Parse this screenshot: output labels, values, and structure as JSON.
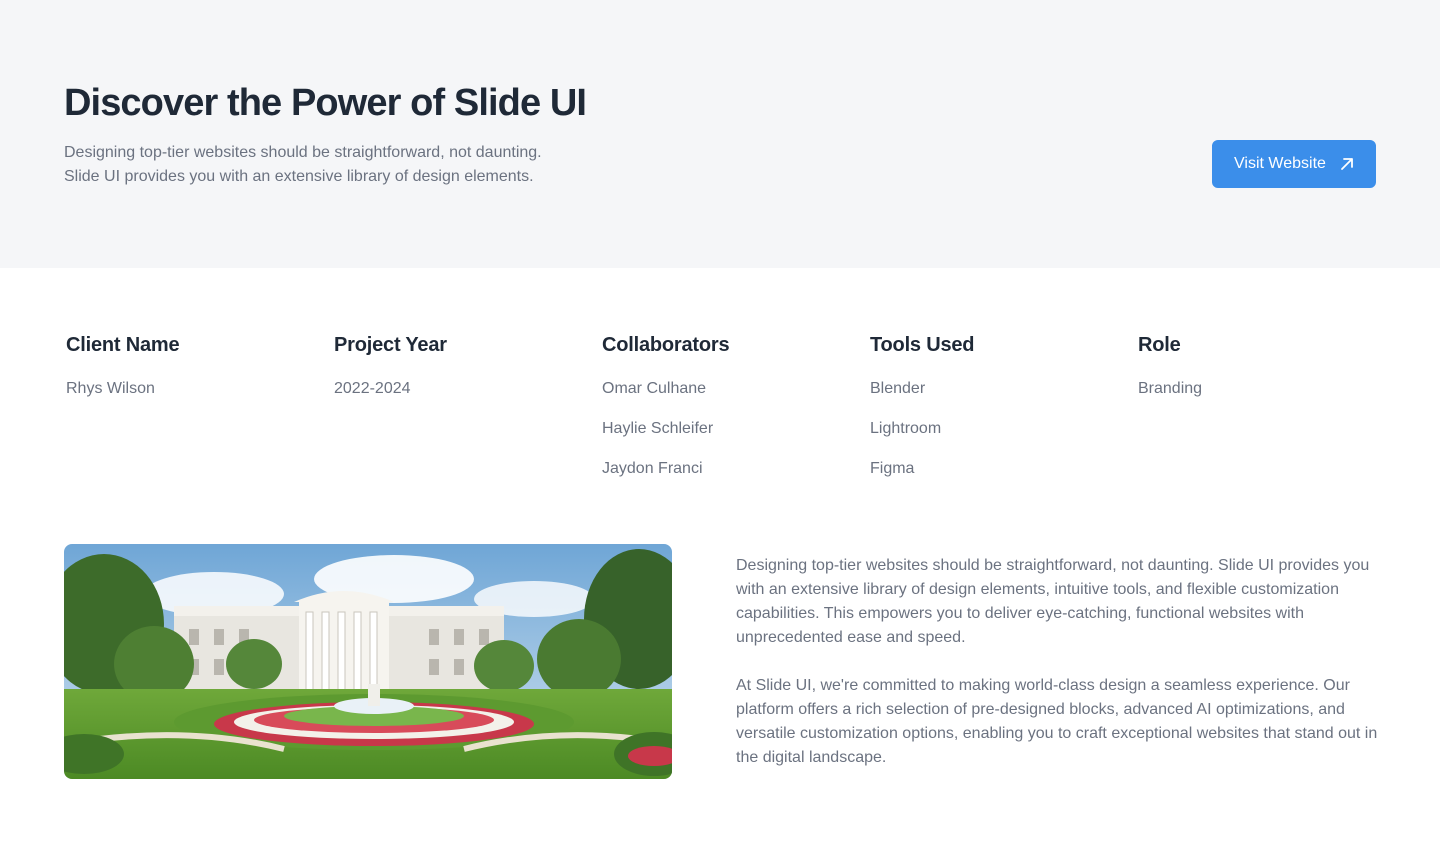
{
  "hero": {
    "title": "Discover the Power of Slide UI",
    "subtitle_line1": "Designing top-tier websites should be straightforward, not daunting.",
    "subtitle_line2": "Slide UI provides you with an extensive library of design elements.",
    "cta_label": "Visit Website",
    "cta_icon": "arrow-up-right-icon",
    "background_color": "#f5f6f8",
    "accent_color": "#3b8eea"
  },
  "details": {
    "client": {
      "heading": "Client Name",
      "items": [
        "Rhys Wilson"
      ]
    },
    "year": {
      "heading": "Project Year",
      "items": [
        "2022-2024"
      ]
    },
    "collaborators": {
      "heading": "Collaborators",
      "items": [
        "Omar Culhane",
        "Haylie Schleifer",
        "Jaydon Franci"
      ]
    },
    "tools": {
      "heading": "Tools Used",
      "items": [
        "Blender",
        "Lightroom",
        "Figma"
      ]
    },
    "role": {
      "heading": "Role",
      "items": [
        "Branding"
      ]
    }
  },
  "content": {
    "paragraph1": "Designing top-tier websites should be straightforward, not daunting. Slide UI provides you with an extensive library of design elements, intuitive tools, and flexible customization capabilities. This empowers you to deliver eye-catching, functional websites with unprecedented ease and speed.",
    "paragraph2": "At Slide UI, we're committed to making world-class design a seamless experience. Our platform offers a rich selection of pre-designed blocks, advanced AI optimizations, and versatile customization options, enabling you to craft exceptional websites that stand out in the digital landscape."
  }
}
